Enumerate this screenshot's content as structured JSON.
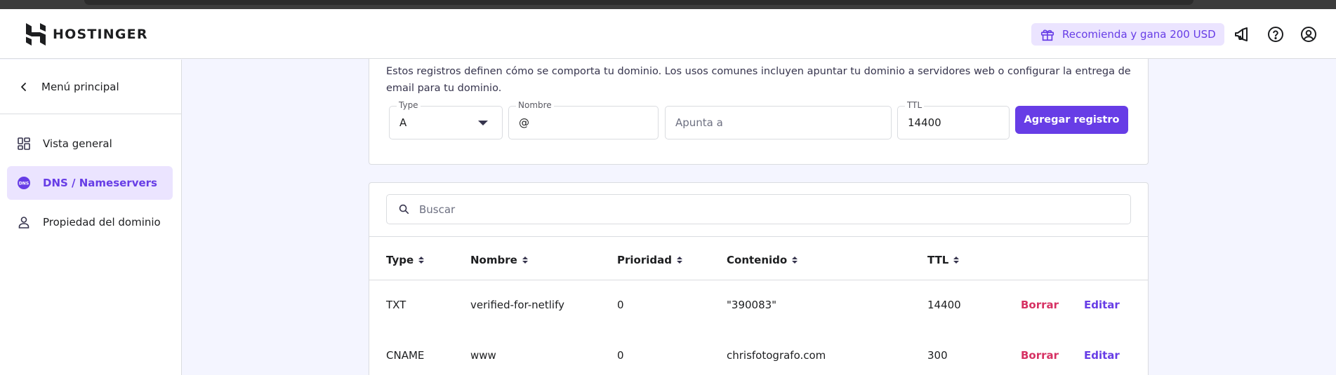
{
  "brand": {
    "name": "HOSTINGER"
  },
  "header": {
    "referral_label": "Recomienda y gana 200 USD",
    "icons": [
      "gift-icon",
      "megaphone-icon",
      "help-icon",
      "account-icon"
    ]
  },
  "sidebar": {
    "back_label": "Menú principal",
    "items": [
      {
        "label": "Vista general",
        "icon": "grid-icon",
        "active": false
      },
      {
        "label": "DNS / Nameservers",
        "icon": "dns-icon",
        "active": true
      },
      {
        "label": "Propiedad del dominio",
        "icon": "person-icon",
        "active": false
      }
    ]
  },
  "form": {
    "description": "Estos registros definen cómo se comporta tu dominio. Los usos comunes incluyen apuntar tu dominio a servidores web o configurar la entrega de email para tu dominio.",
    "type": {
      "label": "Type",
      "value": "A"
    },
    "name": {
      "label": "Nombre",
      "value": "@"
    },
    "points_to": {
      "placeholder": "Apunta a"
    },
    "ttl": {
      "label": "TTL",
      "value": "14400"
    },
    "submit_label": "Agregar registro"
  },
  "table": {
    "search_placeholder": "Buscar",
    "columns": [
      "Type",
      "Nombre",
      "Prioridad",
      "Contenido",
      "TTL"
    ],
    "rows": [
      {
        "type": "TXT",
        "name": "verified-for-netlify",
        "priority": "0",
        "content": "\"390083\"",
        "ttl": "14400",
        "delete": "Borrar",
        "edit": "Editar"
      },
      {
        "type": "CNAME",
        "name": "www",
        "priority": "0",
        "content": "chrisfotografo.com",
        "ttl": "300",
        "delete": "Borrar",
        "edit": "Editar"
      }
    ]
  },
  "colors": {
    "accent": "#673de6",
    "accent_bg": "#ebe4ff",
    "danger": "#d63163"
  }
}
